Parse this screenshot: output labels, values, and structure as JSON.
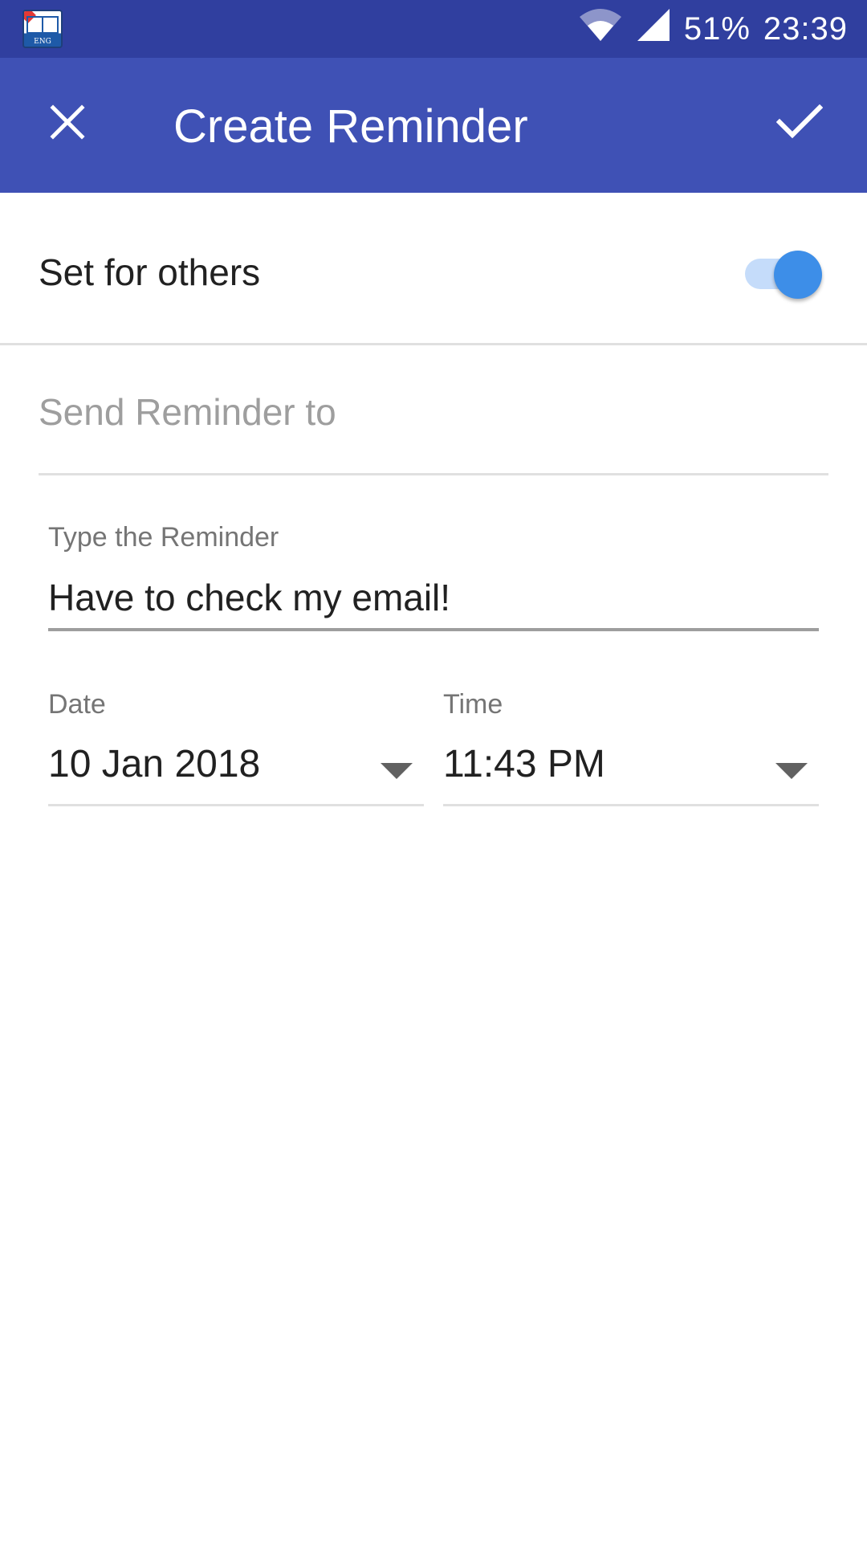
{
  "status_bar": {
    "battery": "51%",
    "time": "23:39",
    "app_icon_text": "ENG"
  },
  "app_bar": {
    "title": "Create Reminder",
    "close_icon": "close-icon",
    "confirm_icon": "check-icon",
    "background_color": "#3f51b5",
    "status_color": "#303f9f"
  },
  "toggle": {
    "label": "Set for others",
    "checked": true,
    "accent_color": "#3d8ee8"
  },
  "recipient": {
    "placeholder": "Send Reminder to",
    "value": ""
  },
  "reminder": {
    "label": "Type the Reminder",
    "value": "Have to check my email!"
  },
  "date": {
    "label": "Date",
    "value": "10 Jan 2018"
  },
  "time": {
    "label": "Time",
    "value": "11:43 PM"
  }
}
